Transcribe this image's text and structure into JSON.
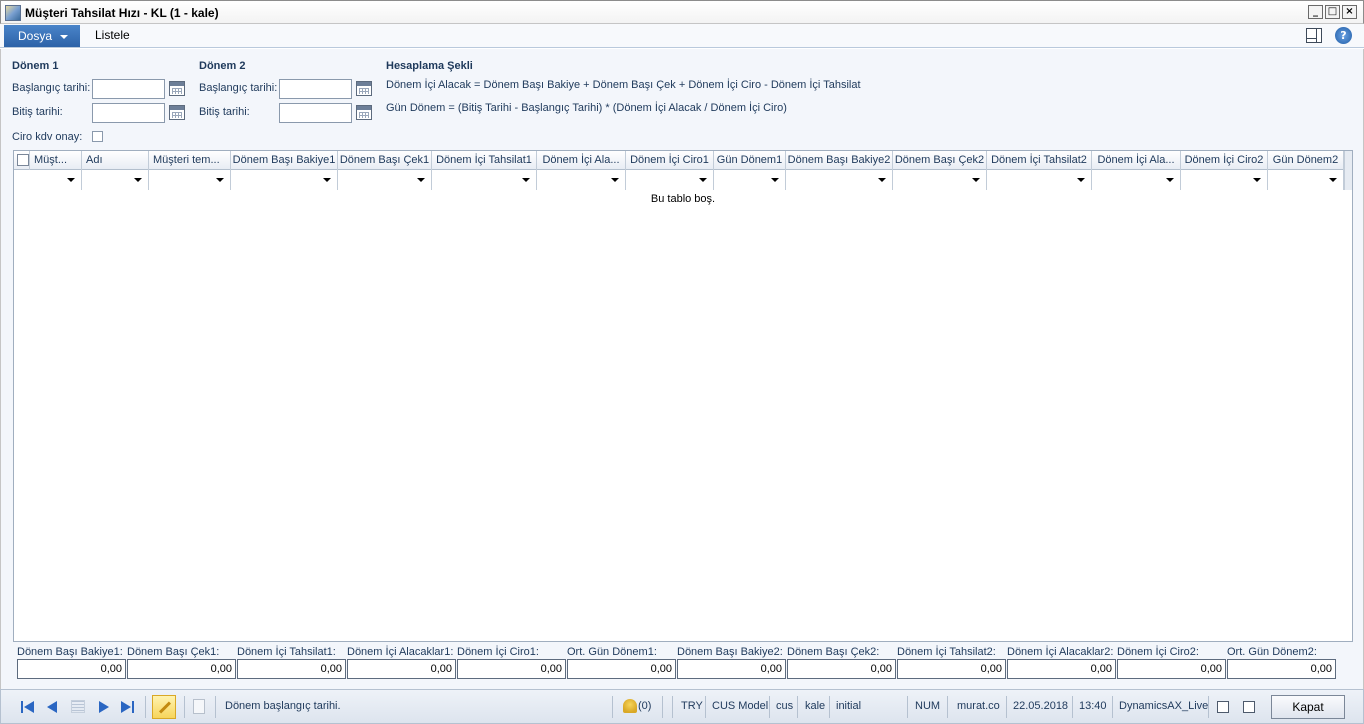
{
  "window": {
    "title": "Müşteri Tahsilat Hızı - KL (1 - kale)",
    "min_label": "_",
    "max_label": "□",
    "close_label": "×"
  },
  "ribbon": {
    "file_tab": "Dosya",
    "tab_list": "Listele",
    "help_label": "?"
  },
  "period1": {
    "heading": "Dönem 1",
    "start_label": "Başlangıç tarihi:",
    "start_value": "",
    "end_label": "Bitiş tarihi:",
    "end_value": "",
    "ciro_kdv_label": "Ciro kdv onay:"
  },
  "period2": {
    "heading": "Dönem 2",
    "start_label": "Başlangıç tarihi:",
    "start_value": "",
    "end_label": "Bitiş tarihi:",
    "end_value": ""
  },
  "calculation": {
    "heading": "Hesaplama Şekli",
    "line1": "Dönem İçi Alacak = Dönem Başı Bakiye + Dönem Başı Çek + Dönem İçi Ciro - Dönem İçi Tahsilat",
    "line2": "Gün Dönem = (Bitiş Tarihi - Başlangıç Tarihi) * (Dönem İçi Alacak / Dönem İçi Ciro)"
  },
  "grid": {
    "columns": [
      "Müşt...",
      "Adı",
      "Müşteri tem...",
      "Dönem Başı Bakiye1",
      "Dönem Başı Çek1",
      "Dönem İçi Tahsilat1",
      "Dönem İçi Ala...",
      "Dönem İçi Ciro1",
      "Gün Dönem1",
      "Dönem Başı Bakiye2",
      "Dönem Başı Çek2",
      "Dönem İçi Tahsilat2",
      "Dönem İçi Ala...",
      "Dönem İçi Ciro2",
      "Gün Dönem2"
    ],
    "empty_text": "Bu tablo boş."
  },
  "totals": [
    {
      "label": "Dönem Başı Bakiye1:",
      "value": "0,00"
    },
    {
      "label": "Dönem Başı Çek1:",
      "value": "0,00"
    },
    {
      "label": "Dönem İçi Tahsilat1:",
      "value": "0,00"
    },
    {
      "label": "Dönem İçi Alacaklar1:",
      "value": "0,00"
    },
    {
      "label": "Dönem İçi Ciro1:",
      "value": "0,00"
    },
    {
      "label": "Ort. Gün Dönem1:",
      "value": "0,00"
    },
    {
      "label": "Dönem Başı Bakiye2:",
      "value": "0,00"
    },
    {
      "label": "Dönem Başı Çek2:",
      "value": "0,00"
    },
    {
      "label": "Dönem İçi Tahsilat2:",
      "value": "0,00"
    },
    {
      "label": "Dönem İçi Alacaklar2:",
      "value": "0,00"
    },
    {
      "label": "Dönem İçi Ciro2:",
      "value": "0,00"
    },
    {
      "label": "Ort. Gün Dönem2:",
      "value": "0,00"
    }
  ],
  "status": {
    "help_text": "Dönem başlangıç tarihi.",
    "notifications": "(0)",
    "currency": "TRY",
    "model": "CUS Model",
    "layer": "cus",
    "company": "kale",
    "partition": "initial",
    "num": "NUM",
    "user": "murat.co",
    "date": "22.05.2018",
    "time": "13:40",
    "server": "DynamicsAX_Live",
    "close_button": "Kapat"
  },
  "colors": {
    "accent": "#2d63a8",
    "nav_arrow": "#2a66c2",
    "panel_bg": "#f3f6fb",
    "label_text": "#1e395b"
  }
}
